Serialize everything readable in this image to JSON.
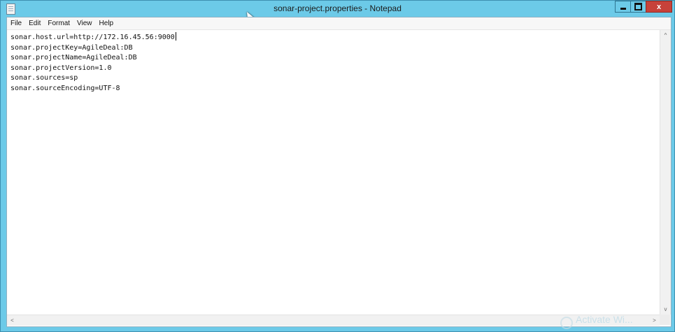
{
  "window": {
    "title": "sonar-project.properties - Notepad",
    "icon": "notepad-icon",
    "controls": {
      "minimize_icon": "minimize-icon",
      "maximize_icon": "maximize-icon",
      "close_icon": "close-icon",
      "close_label": "x"
    }
  },
  "menubar": {
    "items": [
      "File",
      "Edit",
      "Format",
      "View",
      "Help"
    ]
  },
  "editor": {
    "lines": [
      "sonar.host.url=http://172.16.45.56:9000",
      "sonar.projectKey=AgileDeal:DB",
      "sonar.projectName=AgileDeal:DB",
      "sonar.projectVersion=1.0",
      "sonar.sources=sp",
      "sonar.sourceEncoding=UTF-8"
    ]
  },
  "scrollbars": {
    "up": "^",
    "down": "v",
    "left": "<",
    "right": ">"
  },
  "watermark": {
    "text": "Activate Wi..."
  },
  "colors": {
    "titlebar": "#6ccae8",
    "close_button": "#c7423a",
    "editor_bg": "#ffffff"
  }
}
